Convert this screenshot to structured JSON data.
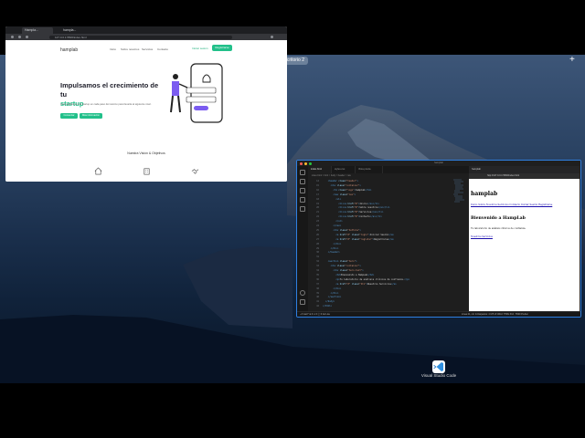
{
  "desktop": {
    "space_label": "Escritorio 2",
    "add_space": "+"
  },
  "browser": {
    "tabs": [
      {
        "label": "Hampla...",
        "active": true
      },
      {
        "label": "hampla...",
        "active": false
      }
    ],
    "url": "127.0.0.1:5500/index.html",
    "site": {
      "logo": "hamplab",
      "nav": [
        "Inicio",
        "Sobre nosotros",
        "Servicios",
        "Contacto"
      ],
      "login": "Iniciar sesión",
      "register": "Registrarse",
      "hero_title_line1": "Impulsamos el crecimiento de tu",
      "hero_title_accent": "startup",
      "hero_text": "Acompañamos a tu startup en cada paso del camino para llevarla al siguiente nivel.",
      "primary_button": "Comenzar",
      "secondary_button": "Más información",
      "section_title": "Nuestra Visión & Objetivos",
      "feature_icons": [
        "home-icon",
        "building-icon",
        "handshake-icon"
      ]
    }
  },
  "vscode": {
    "title": "hamplab",
    "tabs": [
      {
        "label": "index.html",
        "active": true
      },
      {
        "label": "styles.css",
        "active": false
      },
      {
        "label": "Vista previa",
        "active": false
      }
    ],
    "breadcrumb": "index.html > html > body > header > nav",
    "code_lines": [
      {
        "n": "14",
        "indent": 4,
        "parts": [
          {
            "c": "tag",
            "t": "<header"
          },
          {
            "c": "at",
            "t": " class"
          },
          {
            "c": "tx",
            "t": "="
          },
          {
            "c": "st",
            "t": "\"header\""
          },
          {
            "c": "tag",
            "t": ">"
          }
        ]
      },
      {
        "n": "15",
        "indent": 6,
        "parts": [
          {
            "c": "tag",
            "t": "<div"
          },
          {
            "c": "at",
            "t": " class"
          },
          {
            "c": "tx",
            "t": "="
          },
          {
            "c": "st",
            "t": "\"container\""
          },
          {
            "c": "tag",
            "t": ">"
          }
        ]
      },
      {
        "n": "16",
        "indent": 8,
        "parts": [
          {
            "c": "tag",
            "t": "<h1"
          },
          {
            "c": "at",
            "t": " class"
          },
          {
            "c": "tx",
            "t": "="
          },
          {
            "c": "st",
            "t": "\"logo\""
          },
          {
            "c": "tag",
            "t": ">"
          },
          {
            "c": "tx",
            "t": "hamplab"
          },
          {
            "c": "tag",
            "t": "</h1>"
          }
        ]
      },
      {
        "n": "17",
        "indent": 8,
        "parts": [
          {
            "c": "tag",
            "t": "<nav"
          },
          {
            "c": "at",
            "t": " class"
          },
          {
            "c": "tx",
            "t": "="
          },
          {
            "c": "st",
            "t": "\"nav\""
          },
          {
            "c": "tag",
            "t": ">"
          }
        ]
      },
      {
        "n": "18",
        "indent": 10,
        "parts": [
          {
            "c": "tag",
            "t": "<ul>"
          }
        ]
      },
      {
        "n": "19",
        "indent": 12,
        "parts": [
          {
            "c": "tag",
            "t": "<li><a"
          },
          {
            "c": "at",
            "t": " href"
          },
          {
            "c": "tx",
            "t": "="
          },
          {
            "c": "st",
            "t": "\"#\""
          },
          {
            "c": "tag",
            "t": ">"
          },
          {
            "c": "tx",
            "t": "Inicio"
          },
          {
            "c": "tag",
            "t": "</a></li>"
          }
        ]
      },
      {
        "n": "20",
        "indent": 12,
        "parts": [
          {
            "c": "tag",
            "t": "<li><a"
          },
          {
            "c": "at",
            "t": " href"
          },
          {
            "c": "tx",
            "t": "="
          },
          {
            "c": "st",
            "t": "\"#\""
          },
          {
            "c": "tag",
            "t": ">"
          },
          {
            "c": "tx",
            "t": "Sobre nosotros"
          },
          {
            "c": "tag",
            "t": "</a></li>"
          }
        ]
      },
      {
        "n": "21",
        "indent": 12,
        "parts": [
          {
            "c": "tag",
            "t": "<li><a"
          },
          {
            "c": "at",
            "t": " href"
          },
          {
            "c": "tx",
            "t": "="
          },
          {
            "c": "st",
            "t": "\"#\""
          },
          {
            "c": "tag",
            "t": ">"
          },
          {
            "c": "tx",
            "t": "Servicios"
          },
          {
            "c": "tag",
            "t": "</a></li>"
          }
        ]
      },
      {
        "n": "22",
        "indent": 12,
        "parts": [
          {
            "c": "tag",
            "t": "<li><a"
          },
          {
            "c": "at",
            "t": " href"
          },
          {
            "c": "tx",
            "t": "="
          },
          {
            "c": "st",
            "t": "\"#\""
          },
          {
            "c": "tag",
            "t": ">"
          },
          {
            "c": "tx",
            "t": "Contacto"
          },
          {
            "c": "tag",
            "t": "</a></li>"
          }
        ]
      },
      {
        "n": "23",
        "indent": 10,
        "parts": [
          {
            "c": "tag",
            "t": "</ul>"
          }
        ]
      },
      {
        "n": "24",
        "indent": 8,
        "parts": [
          {
            "c": "tag",
            "t": "</nav>"
          }
        ]
      },
      {
        "n": "25",
        "indent": 8,
        "parts": [
          {
            "c": "tag",
            "t": "<div"
          },
          {
            "c": "at",
            "t": " class"
          },
          {
            "c": "tx",
            "t": "="
          },
          {
            "c": "st",
            "t": "\"buttons\""
          },
          {
            "c": "tag",
            "t": ">"
          }
        ]
      },
      {
        "n": "26",
        "indent": 10,
        "parts": [
          {
            "c": "tag",
            "t": "<a"
          },
          {
            "c": "at",
            "t": " href"
          },
          {
            "c": "tx",
            "t": "="
          },
          {
            "c": "st",
            "t": "\"#\""
          },
          {
            "c": "at",
            "t": " class"
          },
          {
            "c": "tx",
            "t": "="
          },
          {
            "c": "st",
            "t": "\"login\""
          },
          {
            "c": "tag",
            "t": ">"
          },
          {
            "c": "tx",
            "t": "Iniciar Sesión"
          },
          {
            "c": "tag",
            "t": "</a>"
          }
        ]
      },
      {
        "n": "27",
        "indent": 10,
        "parts": [
          {
            "c": "tag",
            "t": "<a"
          },
          {
            "c": "at",
            "t": " href"
          },
          {
            "c": "tx",
            "t": "="
          },
          {
            "c": "st",
            "t": "\"#\""
          },
          {
            "c": "at",
            "t": " class"
          },
          {
            "c": "tx",
            "t": "="
          },
          {
            "c": "st",
            "t": "\"register\""
          },
          {
            "c": "tag",
            "t": ">"
          },
          {
            "c": "tx",
            "t": "Registrarse"
          },
          {
            "c": "tag",
            "t": "</a>"
          }
        ]
      },
      {
        "n": "28",
        "indent": 8,
        "parts": [
          {
            "c": "tag",
            "t": "</div>"
          }
        ]
      },
      {
        "n": "29",
        "indent": 6,
        "parts": [
          {
            "c": "tag",
            "t": "</div>"
          }
        ]
      },
      {
        "n": "30",
        "indent": 4,
        "parts": [
          {
            "c": "tag",
            "t": "</header>"
          }
        ]
      },
      {
        "n": "31",
        "indent": 0,
        "parts": []
      },
      {
        "n": "32",
        "indent": 4,
        "parts": [
          {
            "c": "tag",
            "t": "<section"
          },
          {
            "c": "at",
            "t": " class"
          },
          {
            "c": "tx",
            "t": "="
          },
          {
            "c": "st",
            "t": "\"hero\""
          },
          {
            "c": "tag",
            "t": ">"
          }
        ]
      },
      {
        "n": "33",
        "indent": 6,
        "parts": [
          {
            "c": "tag",
            "t": "<div"
          },
          {
            "c": "at",
            "t": " class"
          },
          {
            "c": "tx",
            "t": "="
          },
          {
            "c": "st",
            "t": "\"container\""
          },
          {
            "c": "tag",
            "t": ">"
          }
        ]
      },
      {
        "n": "34",
        "indent": 8,
        "parts": [
          {
            "c": "tag",
            "t": "<div"
          },
          {
            "c": "at",
            "t": " class"
          },
          {
            "c": "tx",
            "t": "="
          },
          {
            "c": "st",
            "t": "\"hero-text\""
          },
          {
            "c": "tag",
            "t": ">"
          }
        ]
      },
      {
        "n": "35",
        "indent": 10,
        "parts": [
          {
            "c": "tag",
            "t": "<h2>"
          },
          {
            "c": "tx",
            "t": "Bienvenido a HampLab"
          },
          {
            "c": "tag",
            "t": "</h2>"
          }
        ]
      },
      {
        "n": "36",
        "indent": 10,
        "parts": [
          {
            "c": "tag",
            "t": "<p>"
          },
          {
            "c": "tx",
            "t": "Tu laboratorio de análisis clínicos de confianza."
          },
          {
            "c": "tag",
            "t": "</p>"
          }
        ]
      },
      {
        "n": "37",
        "indent": 10,
        "parts": [
          {
            "c": "tag",
            "t": "<a"
          },
          {
            "c": "at",
            "t": " href"
          },
          {
            "c": "tx",
            "t": "="
          },
          {
            "c": "st",
            "t": "\"#\""
          },
          {
            "c": "at",
            "t": " class"
          },
          {
            "c": "tx",
            "t": "="
          },
          {
            "c": "st",
            "t": "\"btn\""
          },
          {
            "c": "tag",
            "t": ">"
          },
          {
            "c": "tx",
            "t": "Nuestros Servicios"
          },
          {
            "c": "tag",
            "t": "</a>"
          }
        ]
      },
      {
        "n": "38",
        "indent": 8,
        "parts": [
          {
            "c": "tag",
            "t": "</div>"
          }
        ]
      },
      {
        "n": "39",
        "indent": 6,
        "parts": [
          {
            "c": "tag",
            "t": "</div>"
          }
        ]
      },
      {
        "n": "40",
        "indent": 4,
        "parts": [
          {
            "c": "tag",
            "t": "</section>"
          }
        ]
      },
      {
        "n": "41",
        "indent": 2,
        "parts": [
          {
            "c": "tag",
            "t": "</body>"
          }
        ]
      },
      {
        "n": "42",
        "indent": 0,
        "parts": [
          {
            "c": "tag",
            "t": "</html>"
          }
        ]
      }
    ],
    "preview": {
      "tab_label": "hamplab",
      "url": "http://127.0.0.1:5500/index.html",
      "h1": "hamplab",
      "nav_links": "Inicio Sobre Nosotros Servicios Contacto Iniciar Sesión Registrarse",
      "h2": "Bienvenido a HampLab",
      "paragraph": "Tu laboratorio de análisis clínicos de confianza.",
      "link": "Nuestros Servicios"
    },
    "status_left": "⎇ main*  ⊗ 0 ⚠ 0  ⓘ 0  Go Live",
    "status_right": "Línea 21, col. 44  Espacios: 4  UTF-8  CRLF  HTML  Port : 5500  Prettier"
  },
  "dock": {
    "app_label": "Visual Studio Code"
  },
  "colors": {
    "accent_green": "#22c08a",
    "vscode_border": "#2f7fe0"
  }
}
